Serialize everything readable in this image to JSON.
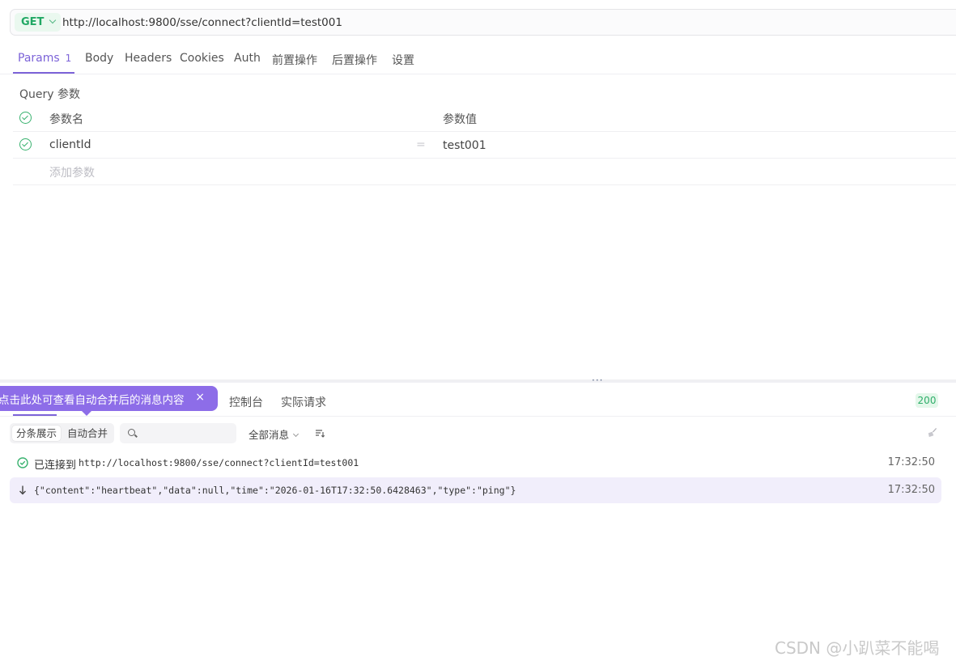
{
  "request": {
    "method": "GET",
    "url": "http://localhost:9800/sse/connect?clientId=test001"
  },
  "request_tabs": [
    {
      "label": "Params",
      "count": "1",
      "active": true
    },
    {
      "label": "Body"
    },
    {
      "label": "Headers"
    },
    {
      "label": "Cookies"
    },
    {
      "label": "Auth"
    },
    {
      "label": "前置操作"
    },
    {
      "label": "后置操作"
    },
    {
      "label": "设置"
    }
  ],
  "params": {
    "section_title": "Query 参数",
    "header_name": "参数名",
    "header_value": "参数值",
    "rows": [
      {
        "name": "clientId",
        "value": "test001",
        "enabled": true
      }
    ],
    "add_placeholder": "添加参数"
  },
  "response": {
    "tooltip": "点击此处可查看自动合并后的消息内容",
    "tabs": [
      "控制台",
      "实际请求"
    ],
    "status_code": "200",
    "view_modes": [
      "分条展示",
      "自动合并"
    ],
    "filter_label": "全部消息",
    "messages": [
      {
        "label": "已连接到",
        "text": "http://localhost:9800/sse/connect?clientId=test001",
        "time": "17:32:50"
      },
      {
        "text": "{\"content\":\"heartbeat\",\"data\":null,\"time\":\"2026-01-16T17:32:50.6428463\",\"type\":\"ping\"}",
        "time": "17:32:50"
      }
    ]
  },
  "watermark": "CSDN @小趴菜不能喝",
  "colors": {
    "accent": "#7c63d8",
    "tooltip": "#8d6de8",
    "success": "#39b26f"
  }
}
